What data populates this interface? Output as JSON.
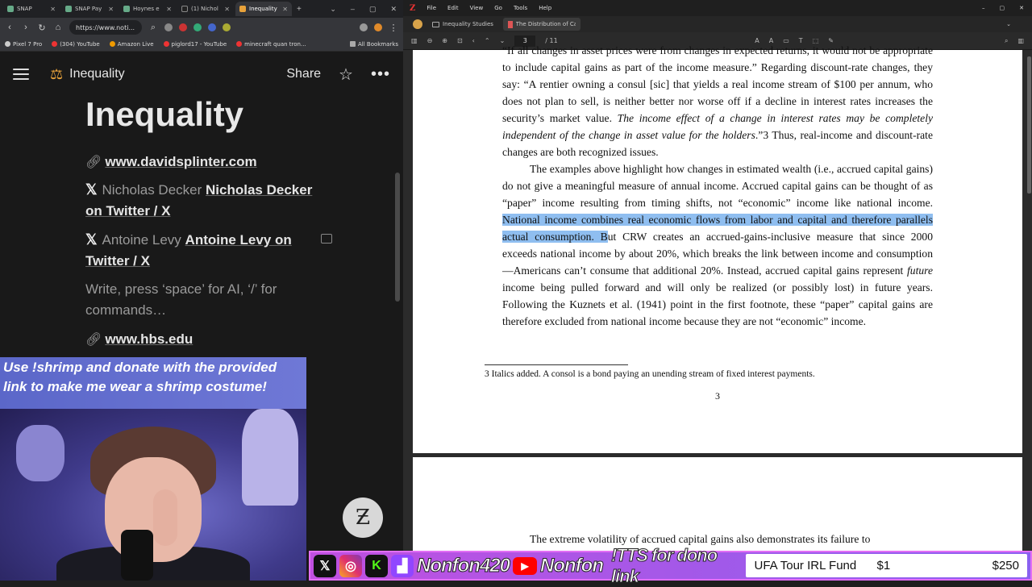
{
  "browser": {
    "tabs": [
      {
        "label": "SNAP",
        "active": false
      },
      {
        "label": "SNAP Pay",
        "active": false
      },
      {
        "label": "Hoynes e",
        "active": false
      },
      {
        "label": "(1) Nichol",
        "active": false
      },
      {
        "label": "Inequality",
        "active": true
      }
    ],
    "url": "https://www.noti...",
    "bookmarks": [
      "Pixel 7 Pro",
      "(304) YouTube",
      "Amazon Live",
      "piglord17 - YouTube",
      "minecraft quan tron..."
    ],
    "all_bookmarks": "All Bookmarks"
  },
  "notion": {
    "header_title": "Inequality",
    "share": "Share",
    "page_title": "Inequality",
    "link1": "www.davidsplinter.com",
    "row2_gray": "Nicholas Decker",
    "row2_bold": "Nicholas Decker on Twitter / X",
    "row3_gray": "Antoine Levy",
    "row3_bold": "Antoine Levy on Twitter / X",
    "placeholder": "Write, press ‘space’ for AI, ‘/’ for commands…",
    "link2": "www.hbs.edu"
  },
  "overlay": {
    "banner": "Use !shrimp and donate with the provided link to make me wear a shrimp costume!"
  },
  "viewer": {
    "menu": [
      "File",
      "Edit",
      "View",
      "Go",
      "Tools",
      "Help"
    ],
    "tabs": [
      "Inequality Studies",
      "The Distribution of Capital"
    ],
    "page_current": "3",
    "page_total": "/ 11",
    "page_number": "3",
    "p1": "“If all changes in asset prices were from changes in expected returns, it would not be appropriate to include capital gains as part of the income measure.” Regarding discount-rate changes, they say: “A rentier owning a consul [sic] that yields a real income stream of $100 per annum, who does not plan to sell, is neither better nor worse off if a decline in interest rates increases the security’s market value.",
    "p1_italic": "The income effect of a change in interest rates may be completely independent of the change in asset value for the holders",
    "p1_end": ".”3 Thus, real-income and discount-rate changes are both recognized issues.",
    "p2_start": "The examples above highlight how changes in estimated wealth (i.e., accrued capital gains) do not give a meaningful measure of annual income. Accrued capital gains can be thought of as “paper” income resulting from timing shifts, not “economic” income like national income.",
    "p2_highlight": "National income combines real economic flows from labor and capital and therefore parallels actual consumption. B",
    "p2_mid": "ut CRW creates an accrued-gains-inclusive measure that since 2000 exceeds national income by about 20%, which breaks the link between income and consumption—Americans can’t consume that additional 20%. Instead, accrued capital gains represent",
    "p2_italic": "future",
    "p2_end": "income being pulled forward and will only be realized (or possibly lost) in future years. Following the Kuznets et al. (1941) point in the first footnote, these “paper” capital gains are therefore excluded from national income because they are not “economic” income.",
    "footnote": "3 Italics added. A consol is a bond paying an unending stream of fixed interest payments.",
    "page2_text": "The extreme volatility of accrued capital gains also demonstrates its failure to"
  },
  "stream_bar": {
    "name1": "Nonfon420",
    "name2": "Nonfon",
    "tts": "!TTS for dono link",
    "fund_name": "UFA Tour IRL Fund",
    "fund_current": "$1",
    "fund_goal": "$250"
  },
  "colors": {
    "highlight": "#8fbef0",
    "accent": "#e8a23a",
    "overlay": "#c050e0"
  }
}
